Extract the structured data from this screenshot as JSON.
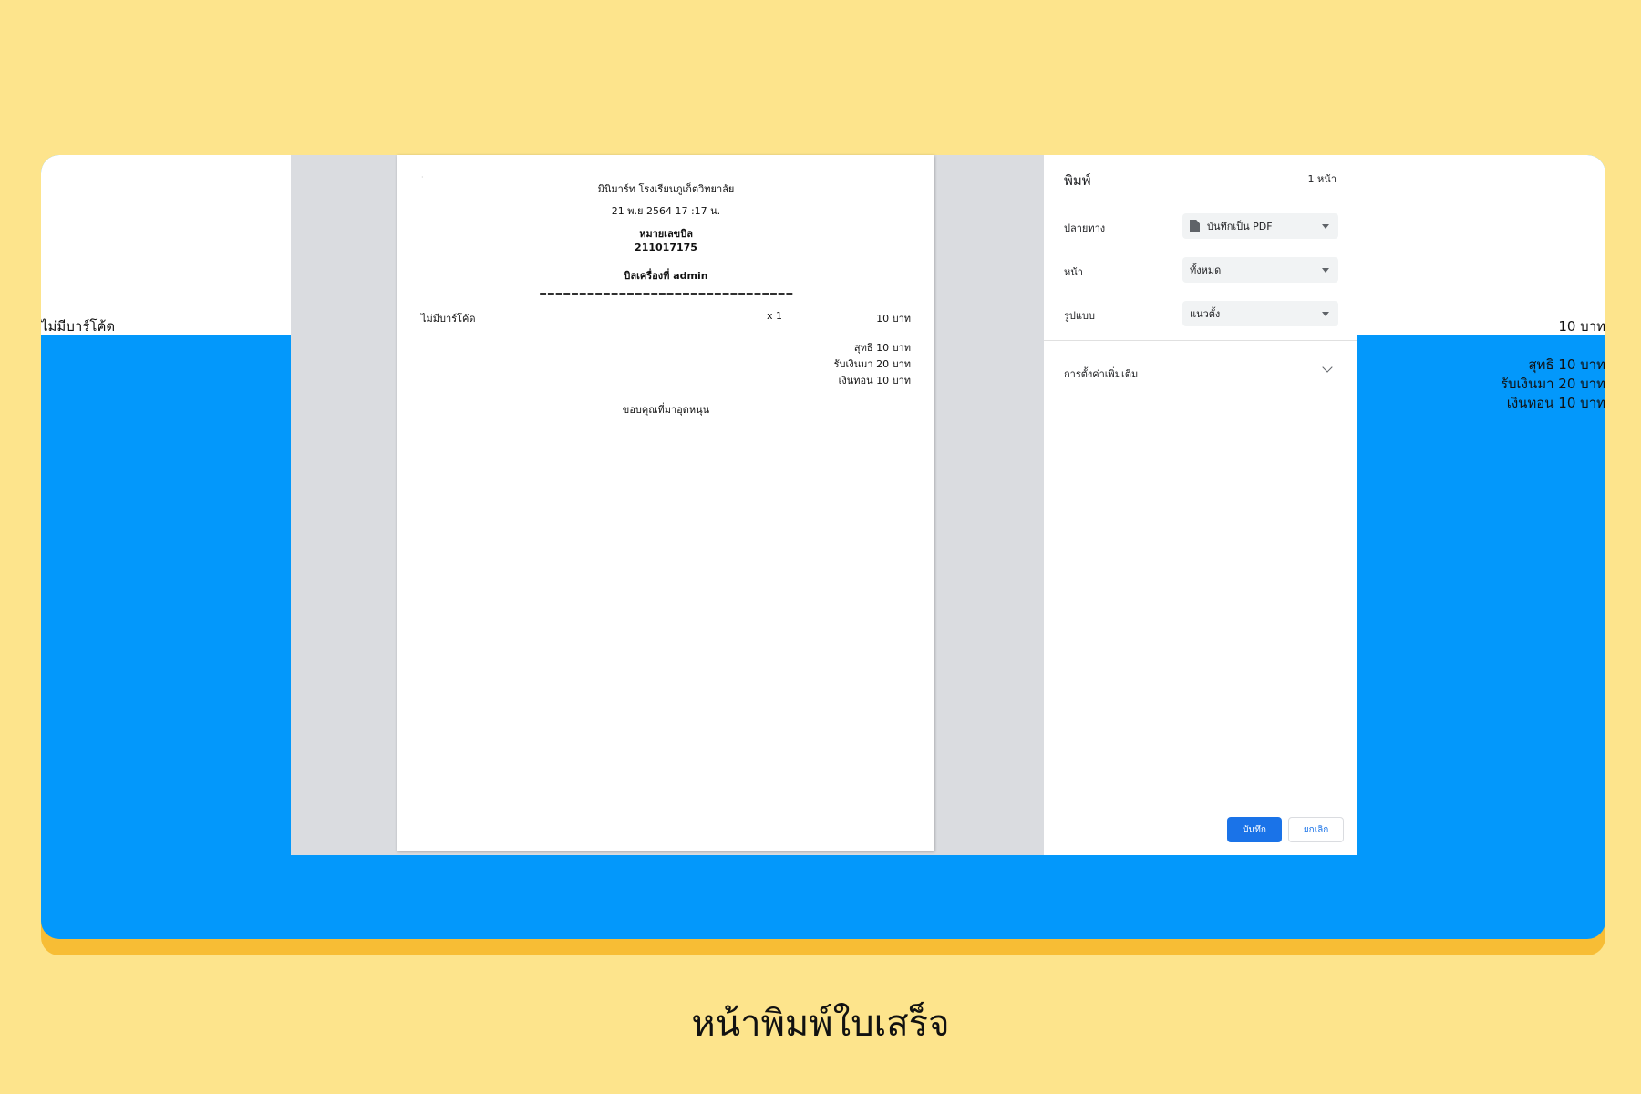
{
  "background": {
    "left_item": "ไม่มีบาร์โค้ด",
    "right_price": "10 บาท",
    "right_net": "สุทธิ 10 บาท",
    "right_received": "รับเงินมา 20 บาท",
    "right_change": "เงินทอน 10 บาท"
  },
  "receipt": {
    "shop": "มินิมาร์ท โรงเรียนภูเก็ตวิทยาลัย",
    "datetime": "21 พ.ย 2564 17 :17 น.",
    "bill_label": "หมายเลขบิล",
    "bill_no": "211017175",
    "machine": "บิลเครื่องที่ admin",
    "separator": "================================",
    "item": {
      "name": "ไม่มีบาร์โค้ด",
      "qty": "x 1",
      "price": "10 บาท"
    },
    "net": "สุทธิ 10 บาท",
    "received": "รับเงินมา 20 บาท",
    "change": "เงินทอน 10 บาท",
    "thanks": "ขอบคุณที่มาอุดหนุน"
  },
  "print_settings": {
    "title": "พิมพ์",
    "page_count": "1 หน้า",
    "destination_label": "ปลายทาง",
    "destination_value": "บันทึกเป็น PDF",
    "pages_label": "หน้า",
    "pages_value": "ทั้งหมด",
    "layout_label": "รูปแบบ",
    "layout_value": "แนวตั้ง",
    "more_settings": "การตั้งค่าเพิ่มเติม",
    "save_button": "บันทึก",
    "cancel_button": "ยกเลิก"
  },
  "caption": "หน้าพิมพ์ใบเสร็จ",
  "colors": {
    "page_bg": "#fde48c",
    "card": "#0398fb",
    "card_shadow": "#f7bd35",
    "primary_button": "#1a73e8"
  }
}
